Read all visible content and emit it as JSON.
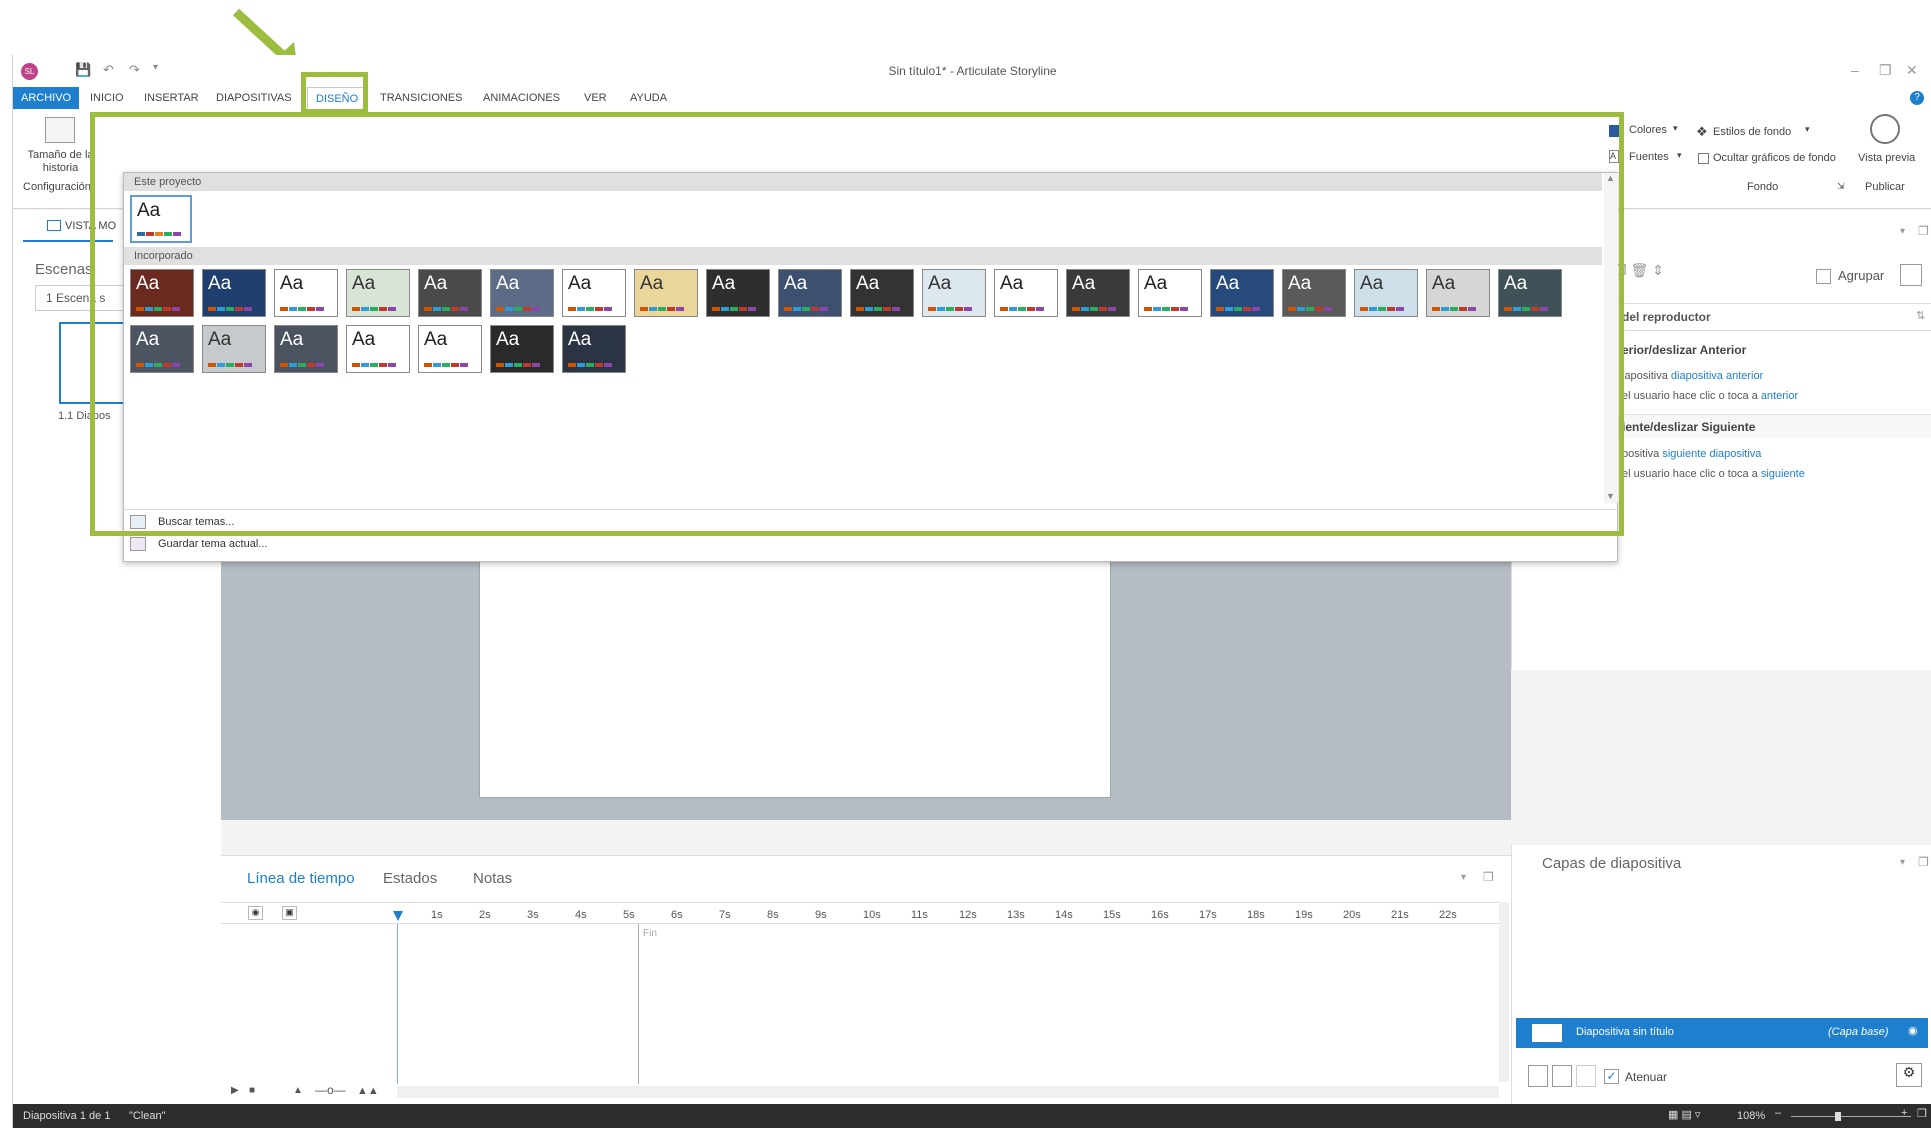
{
  "app": {
    "title": "Sin título1* -  Articulate Storyline",
    "logo": "SL"
  },
  "tabs": [
    "ARCHIVO",
    "INICIO",
    "INSERTAR",
    "DIAPOSITIVAS",
    "DISEÑO",
    "TRANSICIONES",
    "ANIMACIONES",
    "VER",
    "AYUDA"
  ],
  "ribbon": {
    "story_size": "Tamaño de la historia",
    "config_group": "Configuración",
    "colors": "Colores",
    "fonts": "Fuentes",
    "bg_styles": "Estilos de fondo",
    "hide_bg": "Ocultar gráficos de fondo",
    "bg_group": "Fondo",
    "preview": "Vista previa",
    "publish_group": "Publicar"
  },
  "left": {
    "view_tab": "VISTA MO",
    "scenes_title": "Escenas",
    "scene_select": "1 Escena s",
    "slide_label": "1.1 Diapos"
  },
  "right": {
    "group_label": "Agrupar",
    "player_triggers": "del reproductor",
    "prev_heading": "erior/deslizar Anterior",
    "prev_line1_a": "iapositiva ",
    "prev_line1_b": "diapositiva anterior",
    "prev_line2_a": "el usuario hace clic o toca a ",
    "prev_line2_b": "anterior",
    "next_heading": "iente/deslizar Siguiente",
    "next_line1_a": "positiva ",
    "next_line1_b": "siguiente diapositiva",
    "next_line2_a": "el usuario hace clic o toca a ",
    "next_line2_b": "siguiente",
    "layers_title": "Capas de diapositiva",
    "layer_name": "Diapositiva sin título",
    "layer_base": "(Capa base)",
    "dim_label": "Atenuar"
  },
  "timeline": {
    "tabs": [
      "Línea de tiempo",
      "Estados",
      "Notas"
    ],
    "ticks": [
      "1s",
      "2s",
      "3s",
      "4s",
      "5s",
      "6s",
      "7s",
      "8s",
      "9s",
      "10s",
      "11s",
      "12s",
      "13s",
      "14s",
      "15s",
      "16s",
      "17s",
      "18s",
      "19s",
      "20s",
      "21s",
      "22s"
    ],
    "end_label": "Fin"
  },
  "status": {
    "slide_info": "Diapositiva 1 de 1",
    "theme": "\"Clean\"",
    "zoom": "108%"
  },
  "gallery": {
    "section_project": "Este proyecto",
    "section_builtin": "Incorporado",
    "thumb_text": "Aa",
    "browse": "Buscar temas...",
    "save": "Guardar tema actual..."
  },
  "themes_row1": [
    {
      "bg": "#6b2a1f",
      "fg": "#ffffff"
    },
    {
      "bg": "#1f3f6e",
      "fg": "#ffffff"
    },
    {
      "bg": "#ffffff",
      "fg": "#222222"
    },
    {
      "bg": "#d8e4d6",
      "fg": "#333333"
    },
    {
      "bg": "#4a4a4a",
      "fg": "#ffffff"
    },
    {
      "bg": "#5c6b86",
      "fg": "#ffffff"
    },
    {
      "bg": "#ffffff",
      "fg": "#222222"
    },
    {
      "bg": "#ead69a",
      "fg": "#333333"
    },
    {
      "bg": "#2e2e2e",
      "fg": "#ffffff"
    },
    {
      "bg": "#3e5070",
      "fg": "#ffffff"
    },
    {
      "bg": "#333333",
      "fg": "#ffffff"
    },
    {
      "bg": "#dde7ee",
      "fg": "#333333"
    },
    {
      "bg": "#ffffff",
      "fg": "#222222"
    },
    {
      "bg": "#3a3a3a",
      "fg": "#ffffff"
    },
    {
      "bg": "#ffffff",
      "fg": "#222222"
    },
    {
      "bg": "#274a7c",
      "fg": "#ffffff"
    },
    {
      "bg": "#5a5a5a",
      "fg": "#ffffff"
    },
    {
      "bg": "#cde0ea",
      "fg": "#333333"
    },
    {
      "bg": "#d6d6d6",
      "fg": "#333333"
    },
    {
      "bg": "#3f5258",
      "fg": "#ffffff"
    }
  ],
  "themes_row2": [
    {
      "bg": "#4d5563",
      "fg": "#ffffff"
    },
    {
      "bg": "#c6cacd",
      "fg": "#333333"
    },
    {
      "bg": "#4b5360",
      "fg": "#ffffff"
    },
    {
      "bg": "#ffffff",
      "fg": "#222222"
    },
    {
      "bg": "#ffffff",
      "fg": "#222222"
    },
    {
      "bg": "#2a2a2a",
      "fg": "#ffffff"
    },
    {
      "bg": "#2b3442",
      "fg": "#ffffff"
    }
  ],
  "colors": {
    "accent": "#1e7fcf",
    "highlight": "#9cbd3d",
    "status_bg": "#2d2d30"
  }
}
